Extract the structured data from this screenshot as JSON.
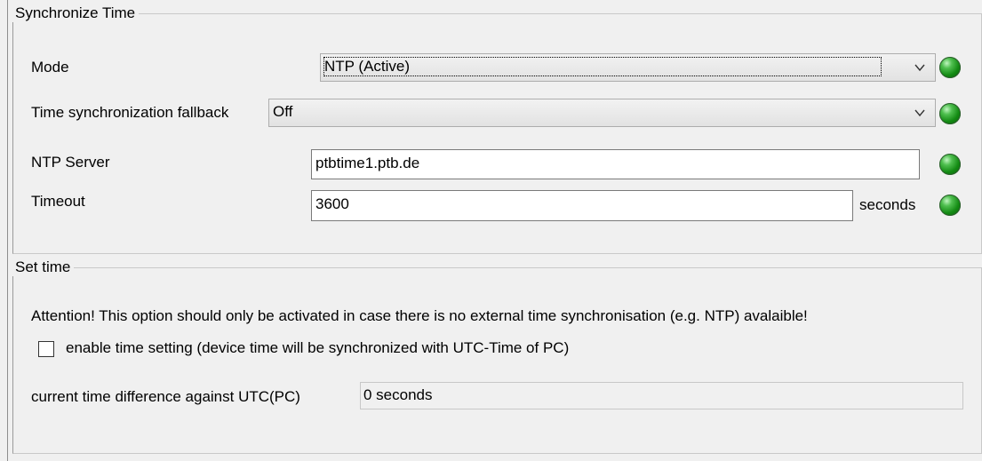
{
  "sync": {
    "title": "Synchronize Time",
    "mode_label": "Mode",
    "mode_value": "NTP (Active)",
    "fallback_label": "Time synchronization fallback",
    "fallback_value": "Off",
    "ntp_label": "NTP Server",
    "ntp_value": "ptbtime1.ptb.de",
    "timeout_label": "Timeout",
    "timeout_value": "3600",
    "timeout_unit": "seconds",
    "status_color": "#139313"
  },
  "settime": {
    "title": "Set time",
    "attention": "Attention! This option should only be activated in case there is no external time synchronisation (e.g. NTP) avalaible!",
    "checkbox_label": "enable time setting (device time will be synchronized with UTC-Time of PC)",
    "checkbox_checked": false,
    "diff_label": "current time difference against UTC(PC)",
    "diff_value": "0 seconds"
  },
  "icons": {
    "dropdown": "chevron-down-icon",
    "status": "status-led-icon"
  }
}
